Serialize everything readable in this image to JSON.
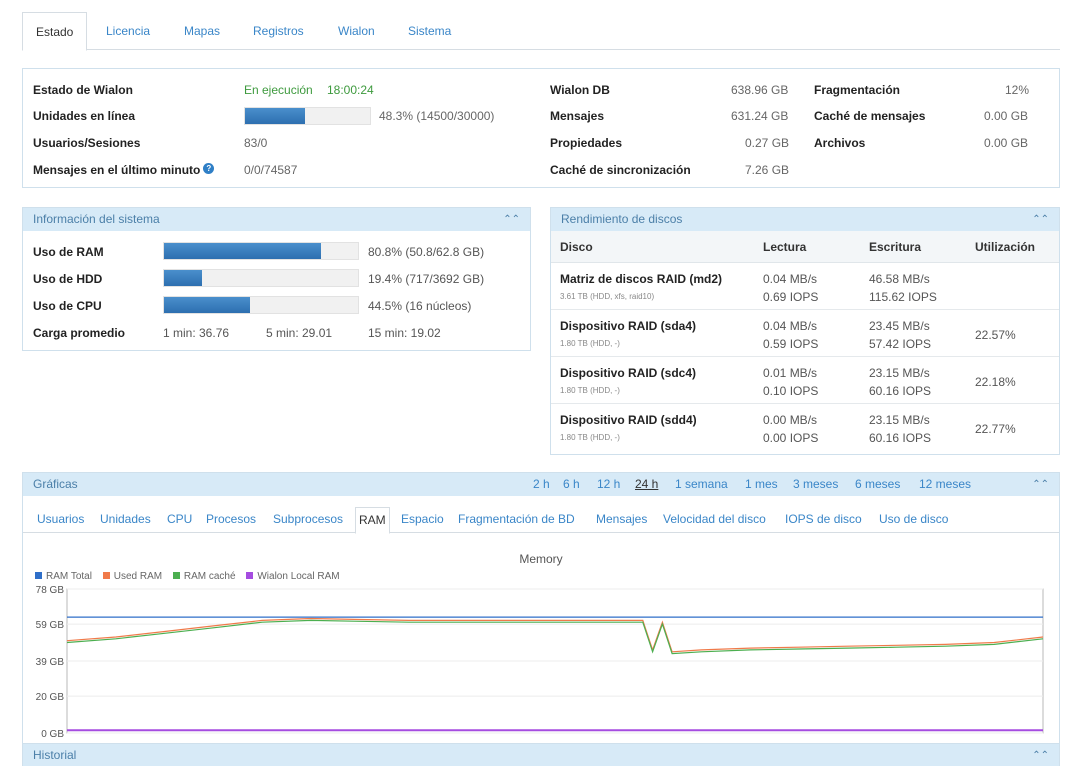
{
  "tabs": [
    "Estado",
    "Licencia",
    "Mapas",
    "Registros",
    "Wialon",
    "Sistema"
  ],
  "status": {
    "wialon_state_label": "Estado de Wialon",
    "wialon_state_value": "En ejecución",
    "wialon_state_time": "18:00:24",
    "units_online_label": "Unidades en línea",
    "units_online_fraction": 0.483,
    "units_online_text": "48.3% (14500/30000)",
    "users_label": "Usuarios/Sesiones",
    "users_value": "83/0",
    "msgs_minute_label": "Mensajes en el último minuto",
    "msgs_minute_value": "0/0/74587",
    "db_label": "Wialon DB",
    "db_value": "638.96 GB",
    "messages_label": "Mensajes",
    "messages_value": "631.24 GB",
    "props_label": "Propiedades",
    "props_value": "0.27 GB",
    "sync_cache_label": "Caché de sincronización",
    "sync_cache_value": "7.26 GB",
    "frag_label": "Fragmentación",
    "frag_value": "12%",
    "msg_cache_label": "Caché de mensajes",
    "msg_cache_value": "0.00 GB",
    "files_label": "Archivos",
    "files_value": "0.00 GB"
  },
  "sysinfo": {
    "title": "Información del sistema",
    "ram_label": "Uso de RAM",
    "ram_fraction": 0.808,
    "ram_text": "80.8% (50.8/62.8 GB)",
    "hdd_label": "Uso de HDD",
    "hdd_fraction": 0.194,
    "hdd_text": "19.4% (717/3692 GB)",
    "cpu_label": "Uso de CPU",
    "cpu_fraction": 0.445,
    "cpu_text": "44.5% (16 núcleos)",
    "load_label": "Carga promedio",
    "load_1": "1 min: 36.76",
    "load_5": "5 min: 29.01",
    "load_15": "15 min: 19.02"
  },
  "disks": {
    "title": "Rendimiento de discos",
    "headers": [
      "Disco",
      "Lectura",
      "Escritura",
      "Utilización"
    ],
    "rows": [
      {
        "name": "Matriz de discos RAID (md2)",
        "sub": "3.61 TB (HDD, xfs, raid10)",
        "read_mb": "0.04 MB/s",
        "read_iops": "0.69 IOPS",
        "write_mb": "46.58 MB/s",
        "write_iops": "115.62 IOPS",
        "util": ""
      },
      {
        "name": "Dispositivo RAID (sda4)",
        "sub": "1.80 TB (HDD, -)",
        "read_mb": "0.04 MB/s",
        "read_iops": "0.59 IOPS",
        "write_mb": "23.45 MB/s",
        "write_iops": "57.42 IOPS",
        "util": "22.57%"
      },
      {
        "name": "Dispositivo RAID (sdc4)",
        "sub": "1.80 TB (HDD, -)",
        "read_mb": "0.01 MB/s",
        "read_iops": "0.10 IOPS",
        "write_mb": "23.15 MB/s",
        "write_iops": "60.16 IOPS",
        "util": "22.18%"
      },
      {
        "name": "Dispositivo RAID (sdd4)",
        "sub": "1.80 TB (HDD, -)",
        "read_mb": "0.00 MB/s",
        "read_iops": "0.00 IOPS",
        "write_mb": "23.15 MB/s",
        "write_iops": "60.16 IOPS",
        "util": "22.77%"
      }
    ]
  },
  "graphs": {
    "title": "Gráficas",
    "ranges": [
      "2 h",
      "6 h",
      "12 h",
      "24 h",
      "1 semana",
      "1 mes",
      "3 meses",
      "6 meses",
      "12 meses"
    ],
    "selected_range": "24 h",
    "tabs": [
      "Usuarios",
      "Unidades",
      "CPU",
      "Procesos",
      "Subprocesos",
      "RAM",
      "Espacio",
      "Fragmentación de BD",
      "Mensajes",
      "Velocidad del disco",
      "IOPS de disco",
      "Uso de disco"
    ],
    "active_tab": "RAM"
  },
  "history": {
    "title": "Historial"
  },
  "icons": {
    "help": "help-icon",
    "collapse": "collapse-up-icon"
  },
  "colors": {
    "accent": "#3a86c8",
    "header_bg": "#d7eaf7",
    "bar": "#2d6fb0",
    "running": "#3e9a3e"
  },
  "chart_data": {
    "type": "line",
    "title": "Memory",
    "xlabel": "",
    "ylabel": "",
    "ylim": [
      0,
      78
    ],
    "yticks": [
      "0 GB",
      "20 GB",
      "39 GB",
      "59 GB",
      "78 GB"
    ],
    "x": [
      0,
      0.05,
      0.1,
      0.15,
      0.2,
      0.25,
      0.3,
      0.35,
      0.4,
      0.45,
      0.5,
      0.55,
      0.59,
      0.6,
      0.61,
      0.62,
      0.65,
      0.7,
      0.75,
      0.8,
      0.85,
      0.9,
      0.95,
      1.0
    ],
    "series": [
      {
        "name": "RAM Total",
        "color": "#2f6fc9",
        "values": [
          62.8,
          62.8,
          62.8,
          62.8,
          62.8,
          62.8,
          62.8,
          62.8,
          62.8,
          62.8,
          62.8,
          62.8,
          62.8,
          62.8,
          62.8,
          62.8,
          62.8,
          62.8,
          62.8,
          62.8,
          62.8,
          62.8,
          62.8,
          62.8
        ]
      },
      {
        "name": "Used RAM",
        "color": "#f07a4a",
        "values": [
          50,
          52,
          55,
          58,
          61,
          62,
          61.5,
          61,
          61,
          61,
          61,
          61,
          61,
          45,
          60,
          44,
          45,
          46,
          46.5,
          47,
          47.5,
          48,
          49,
          52
        ]
      },
      {
        "name": "RAM caché",
        "color": "#4caf50",
        "values": [
          49,
          51,
          54,
          57,
          60,
          61,
          60.5,
          60,
          60,
          60,
          60,
          60,
          60,
          44,
          59,
          43,
          44,
          45,
          45.5,
          46,
          46.5,
          47,
          48,
          51
        ]
      },
      {
        "name": "Wialon Local RAM",
        "color": "#a54ce0",
        "values": [
          1.5,
          1.5,
          1.5,
          1.5,
          1.5,
          1.5,
          1.5,
          1.5,
          1.5,
          1.5,
          1.5,
          1.5,
          1.5,
          1.5,
          1.5,
          1.5,
          1.5,
          1.5,
          1.5,
          1.5,
          1.5,
          1.5,
          1.5,
          1.5
        ]
      }
    ]
  }
}
